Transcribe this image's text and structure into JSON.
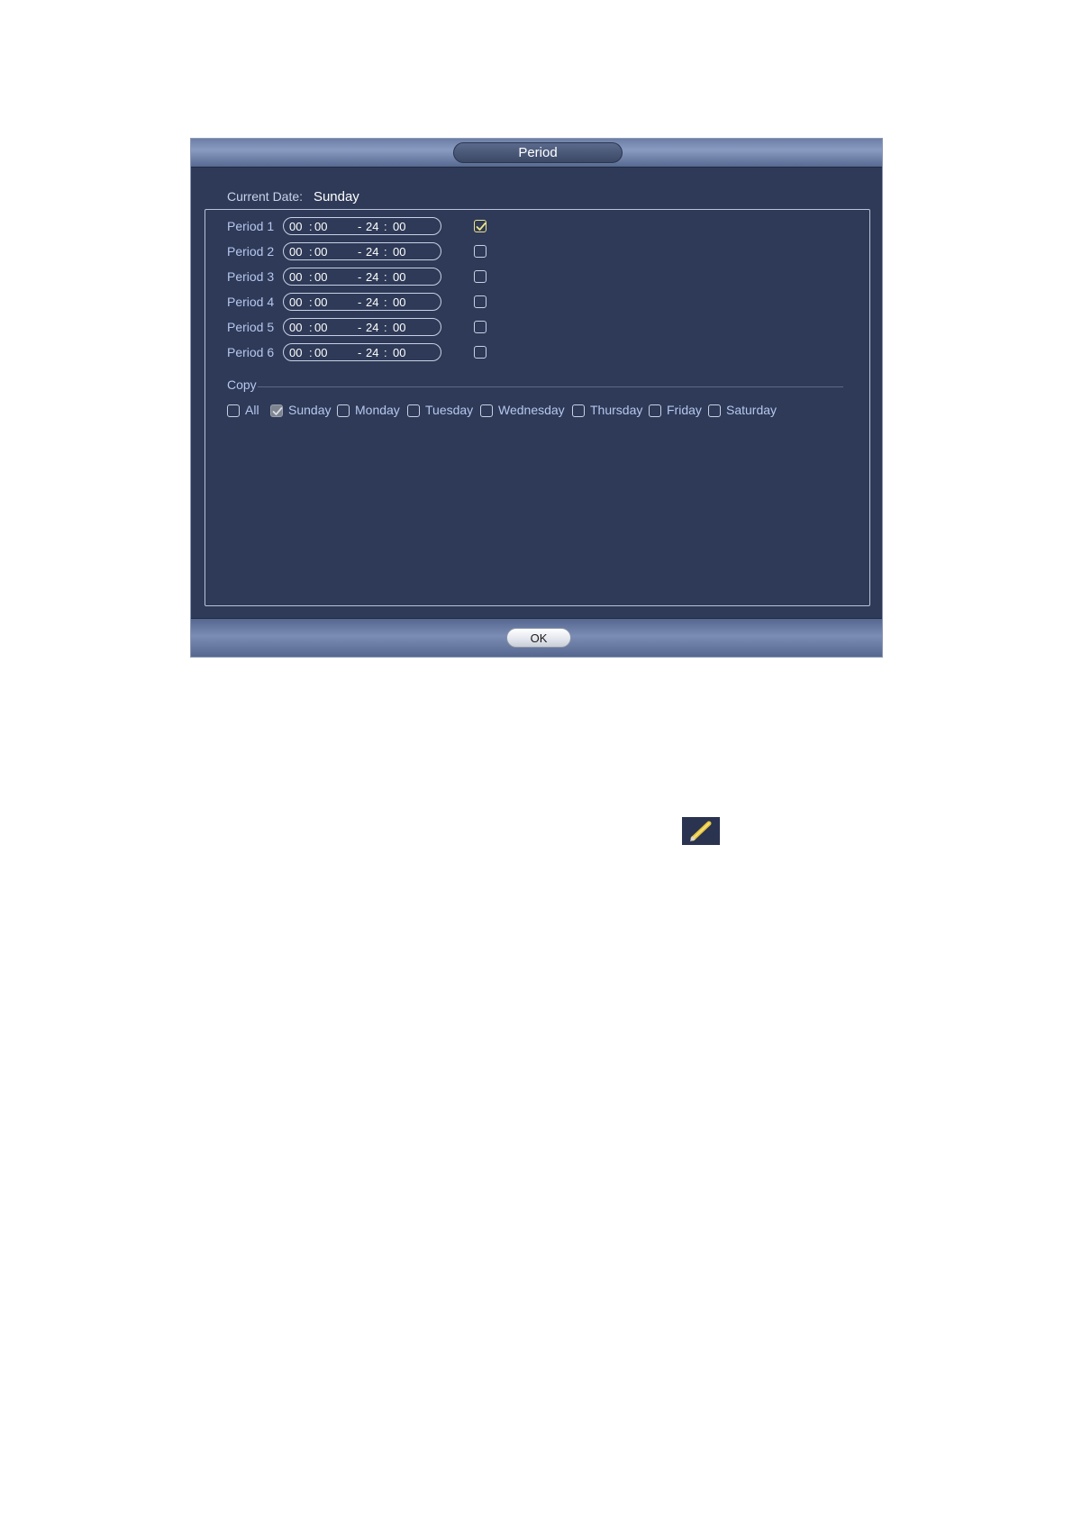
{
  "dialog": {
    "title": "Period",
    "current_date_label": "Current Date:",
    "current_date_value": "Sunday",
    "periods": [
      {
        "label": "Period 1",
        "start_h": "00",
        "start_m": "00",
        "end_h": "24",
        "end_m": "00",
        "checked": true
      },
      {
        "label": "Period 2",
        "start_h": "00",
        "start_m": "00",
        "end_h": "24",
        "end_m": "00",
        "checked": false
      },
      {
        "label": "Period 3",
        "start_h": "00",
        "start_m": "00",
        "end_h": "24",
        "end_m": "00",
        "checked": false
      },
      {
        "label": "Period 4",
        "start_h": "00",
        "start_m": "00",
        "end_h": "24",
        "end_m": "00",
        "checked": false
      },
      {
        "label": "Period 5",
        "start_h": "00",
        "start_m": "00",
        "end_h": "24",
        "end_m": "00",
        "checked": false
      },
      {
        "label": "Period 6",
        "start_h": "00",
        "start_m": "00",
        "end_h": "24",
        "end_m": "00",
        "checked": false
      }
    ],
    "copy_label": "Copy",
    "days": [
      {
        "label": "All",
        "checked": false
      },
      {
        "label": "Sunday",
        "checked": true
      },
      {
        "label": "Monday",
        "checked": false
      },
      {
        "label": "Tuesday",
        "checked": false
      },
      {
        "label": "Wednesday",
        "checked": false
      },
      {
        "label": "Thursday",
        "checked": false
      },
      {
        "label": "Friday",
        "checked": false
      },
      {
        "label": "Saturday",
        "checked": false
      }
    ],
    "ok_label": "OK"
  },
  "icons": {
    "pencil": "pencil-icon"
  },
  "colors": {
    "panel_bg": "#2e3a57",
    "label_text": "#b7c7ee",
    "checked_accent": "#f1e48a"
  }
}
